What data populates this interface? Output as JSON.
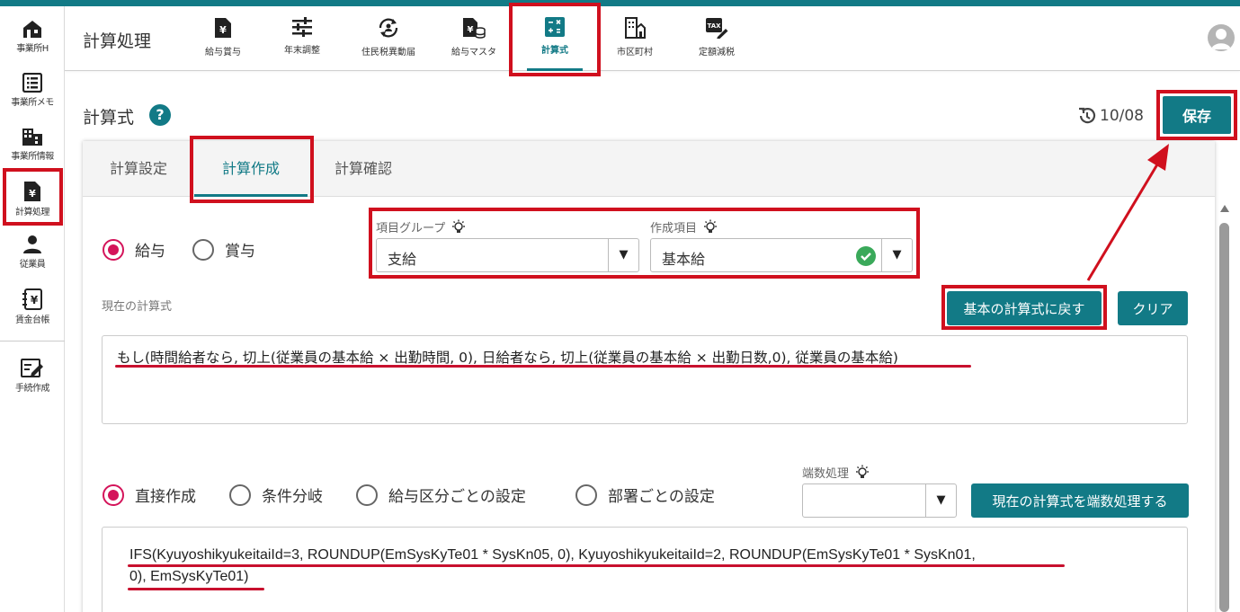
{
  "colors": {
    "accent": "#127a86",
    "radio_selected": "#d4145a",
    "annotation_red": "#d0101e"
  },
  "sidebar": {
    "items": [
      {
        "label": "事業所H",
        "icon": "home-icon"
      },
      {
        "label": "事業所メモ",
        "icon": "memo-list-icon"
      },
      {
        "label": "事業所情報",
        "icon": "building-icon"
      },
      {
        "label": "計算処理",
        "icon": "yen-document-icon"
      },
      {
        "label": "従業員",
        "icon": "person-icon"
      },
      {
        "label": "賃金台帳",
        "icon": "ledger-icon"
      },
      {
        "label": "手続作成",
        "icon": "edit-form-icon"
      }
    ]
  },
  "header": {
    "title": "計算処理",
    "nav": [
      {
        "label": "給与賞与",
        "icon": "yen-document-icon"
      },
      {
        "label": "年末調整",
        "icon": "sliders-icon"
      },
      {
        "label": "住民税異動届",
        "icon": "refresh-person-icon"
      },
      {
        "label": "給与マスタ",
        "icon": "yen-database-icon"
      },
      {
        "label": "計算式",
        "icon": "calculator-icon"
      },
      {
        "label": "市区町村",
        "icon": "city-building-icon"
      },
      {
        "label": "定額減税",
        "icon": "tax-edit-icon"
      }
    ],
    "active_nav": "計算式"
  },
  "page": {
    "title": "計算式",
    "help": "?",
    "version": "10/08",
    "save_label": "保存"
  },
  "tabs": [
    {
      "label": "計算設定"
    },
    {
      "label": "計算作成"
    },
    {
      "label": "計算確認"
    }
  ],
  "active_tab": "計算作成",
  "type_radios": [
    {
      "label": "給与",
      "checked": true
    },
    {
      "label": "賞与",
      "checked": false
    }
  ],
  "item_group": {
    "label": "項目グループ",
    "value": "支給"
  },
  "creation_item": {
    "label": "作成項目",
    "value": "基本給"
  },
  "current_formula": {
    "label": "現在の計算式",
    "reset_label": "基本の計算式に戻す",
    "clear_label": "クリア",
    "text": "もし(時間給者なら, 切上(従業員の基本給 × 出勤時間, 0), 日給者なら, 切上(従業員の基本給 × 出勤日数,0), 従業員の基本給)"
  },
  "mode_radios": [
    {
      "label": "直接作成",
      "checked": true
    },
    {
      "label": "条件分岐",
      "checked": false
    },
    {
      "label": "給与区分ごとの設定",
      "checked": false
    },
    {
      "label": "部署ごとの設定",
      "checked": false
    }
  ],
  "rounding": {
    "label": "端数処理",
    "value": "",
    "apply_label": "現在の計算式を端数処理する"
  },
  "direct_formula": {
    "line1": "IFS(KyuyoshikyukeitaiId=3, ROUNDUP(EmSysKyTe01 * SysKn05, 0), KyuyoshikyukeitaiId=2, ROUNDUP(EmSysKyTe01 * SysKn01,",
    "line2": "0), EmSysKyTe01)"
  }
}
